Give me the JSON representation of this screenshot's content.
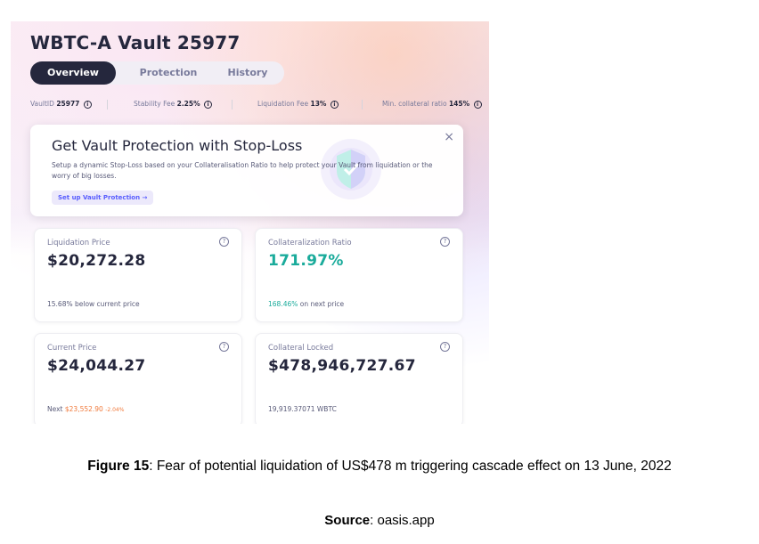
{
  "vault": {
    "title": "WBTC-A Vault 25977",
    "tabs": [
      "Overview",
      "Protection",
      "History"
    ],
    "stats": [
      {
        "label": "VaultID",
        "value": "25977"
      },
      {
        "label": "Stability Fee",
        "value": "2.25%"
      },
      {
        "label": "Liquidation Fee",
        "value": "13%"
      },
      {
        "label": "Min. collateral ratio",
        "value": "145%"
      }
    ],
    "info_glyph": "i"
  },
  "banner": {
    "title": "Get Vault Protection with Stop-Loss",
    "text": "Setup a dynamic Stop-Loss based on your Collateralisation Ratio to help protect your Vault from liquidation or the worry of big losses.",
    "button": "Set up Vault Protection →",
    "close": "×"
  },
  "cards": [
    {
      "label": "Liquidation Price",
      "value": "$20,272.28",
      "foot": "15.68% below current price"
    },
    {
      "label": "Collateralization Ratio",
      "value": "171.97%",
      "foot_highlight": "168.46%",
      "foot": "on next price"
    },
    {
      "label": "Current Price",
      "value": "$24,044.27",
      "foot_prefix": "Next",
      "foot_highlight": "$23,552.90",
      "foot_change": "-2.04%"
    },
    {
      "label": "Collateral Locked",
      "value": "$478,946,727.67",
      "foot_value": "19,919.37071",
      "foot_unit": "WBTC"
    }
  ],
  "help_glyph": "?",
  "caption": {
    "label": "Figure 15",
    "text": ": Fear of potential liquidation of US$478 m triggering cascade effect on 13 June, 2022"
  },
  "source": {
    "label": "Source",
    "text": ": oasis.app"
  },
  "colors": {
    "dark": "#25273d",
    "accent_green": "#1aab9b",
    "accent_orange": "#f0793b",
    "accent_purple": "#575cfe"
  }
}
